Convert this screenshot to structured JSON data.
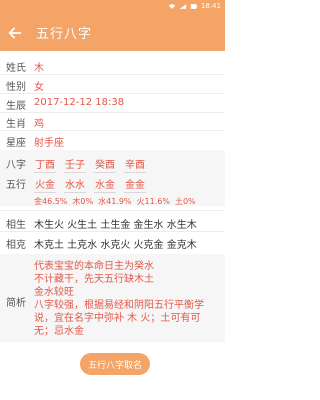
{
  "status_bar": {
    "time": "18:41"
  },
  "app_bar": {
    "title": "五行八字"
  },
  "info": {
    "name_label": "姓氏",
    "name": "木",
    "gender_label": "性别",
    "gender": "女",
    "birth_label": "生辰",
    "birth": "2017-12-12 18:38",
    "zodiac_label": "生肖",
    "zodiac": "鸡",
    "sign_label": "星座",
    "sign": "射手座"
  },
  "bazi": {
    "label": "八字",
    "cells": [
      "丁酉",
      "壬子",
      "癸酉",
      "辛酉"
    ]
  },
  "wuxing": {
    "label": "五行",
    "cells": [
      "火金",
      "水水",
      "水金",
      "金金"
    ],
    "percent_text": [
      "金46.5%",
      "木0%",
      "水41.9%",
      "火11.6%",
      "土0%"
    ]
  },
  "relations": {
    "sheng_label": "相生",
    "sheng": "木生火 火生土 土生金 金生水 水生木",
    "ke_label": "相克",
    "ke": "木克土 土克水 水克火 火克金 金克木"
  },
  "analysis": {
    "label": "简析",
    "lines": [
      "代表宝宝的本命日主为癸水",
      "不计藏干，先天五行缺木土",
      "金水较旺",
      "八字较强，根据易经和阴阳五行平衡学说，宜在名字中弥补 木 火；土可有可无；忌水金"
    ]
  },
  "action": {
    "button_label": "五行八字取名"
  },
  "colors": {
    "accent": "#f5a467",
    "value_red": "#e2584a"
  }
}
